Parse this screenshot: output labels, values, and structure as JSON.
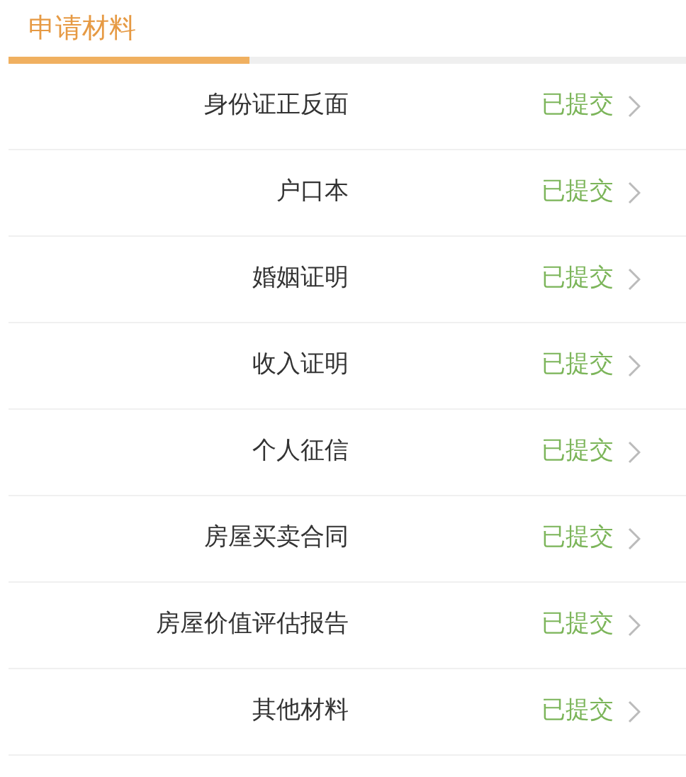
{
  "tabs": [
    {
      "label": "申请材料",
      "selected": true
    }
  ],
  "materials": [
    {
      "name": "身份证正反面",
      "status": "已提交"
    },
    {
      "name": "户口本",
      "status": "已提交"
    },
    {
      "name": "婚姻证明",
      "status": "已提交"
    },
    {
      "name": "收入证明",
      "status": "已提交"
    },
    {
      "name": "个人征信",
      "status": "已提交"
    },
    {
      "name": "房屋买卖合同",
      "status": "已提交"
    },
    {
      "name": "房屋价值评估报告",
      "status": "已提交"
    },
    {
      "name": "其他材料",
      "status": "已提交"
    }
  ]
}
